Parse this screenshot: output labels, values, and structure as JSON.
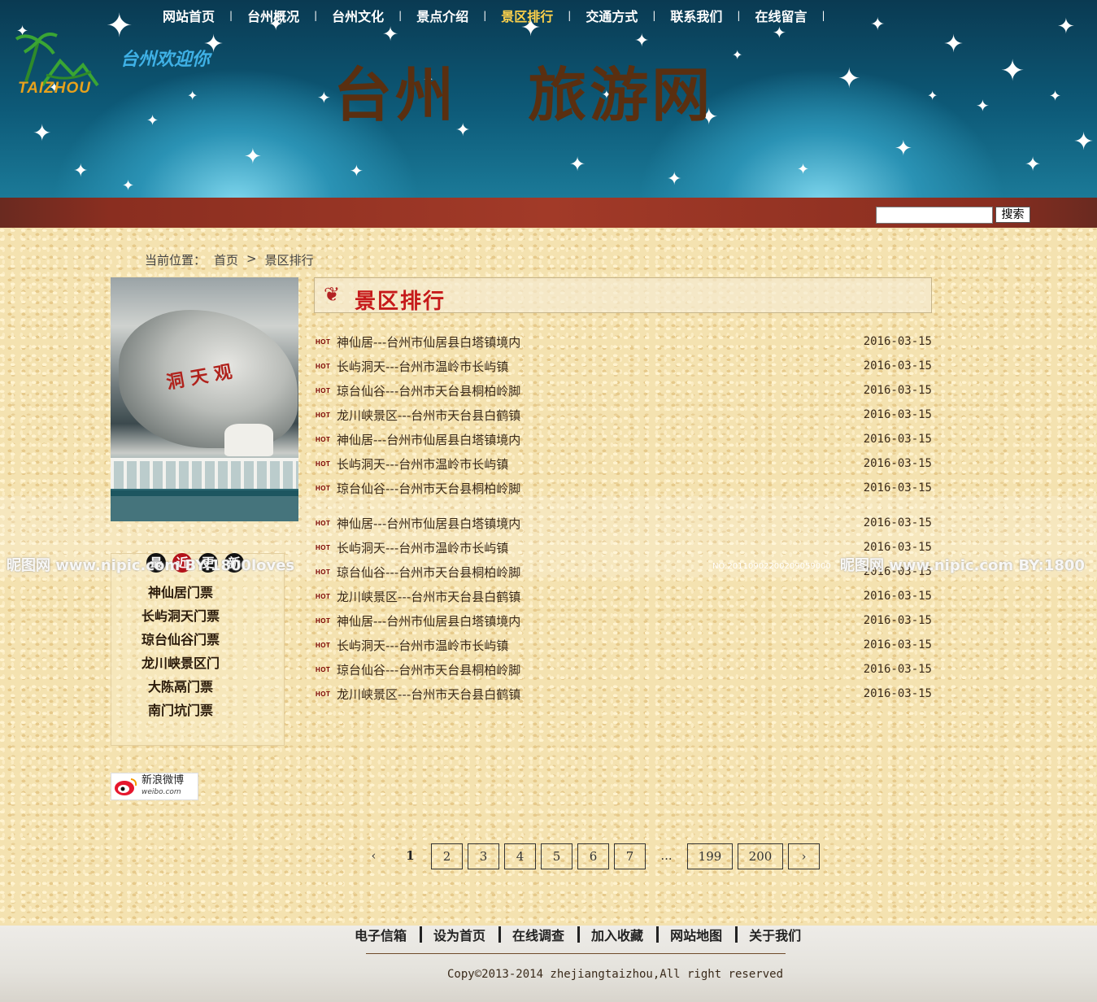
{
  "header": {
    "logo_text": "TAIZHOU",
    "welcome": "台州欢迎你",
    "site_title": "台州   旅游网"
  },
  "nav": {
    "items": [
      {
        "label": "网站首页",
        "active": false
      },
      {
        "label": "台州概况",
        "active": false
      },
      {
        "label": "台州文化",
        "active": false
      },
      {
        "label": "景点介绍",
        "active": false
      },
      {
        "label": "景区排行",
        "active": true
      },
      {
        "label": "交通方式",
        "active": false
      },
      {
        "label": "联系我们",
        "active": false
      },
      {
        "label": "在线留言",
        "active": false
      }
    ],
    "separator": "|",
    "search_value": "",
    "search_button": "搜索"
  },
  "breadcrumb": {
    "prefix": "当前位置：",
    "home": "首页",
    "arrow": ">",
    "current": "景区排行"
  },
  "left": {
    "photo_text": "洞 天 观",
    "ticket_header": [
      "最",
      "近",
      "更",
      "新"
    ],
    "tickets": [
      "神仙居门票",
      "长屿洞天门票",
      "琼台仙谷门票",
      "龙川峡景区门",
      "大陈鬲门票",
      "南门坑门票"
    ],
    "weibo_label": "新浪微博",
    "weibo_domain": "weibo.com"
  },
  "main": {
    "panel_title": "景区排行",
    "hot_label": "HOT",
    "rows": [
      {
        "text": "神仙居---台州市仙居县白塔镇境内",
        "date": "2016-03-15"
      },
      {
        "text": "长屿洞天---台州市温岭市长屿镇",
        "date": "2016-03-15"
      },
      {
        "text": "琼台仙谷---台州市天台县桐柏岭脚",
        "date": "2016-03-15"
      },
      {
        "text": "龙川峡景区---台州市天台县白鹤镇",
        "date": "2016-03-15"
      },
      {
        "text": "神仙居---台州市仙居县白塔镇境内",
        "date": "2016-03-15"
      },
      {
        "text": "长屿洞天---台州市温岭市长屿镇",
        "date": "2016-03-15"
      },
      {
        "text": "琼台仙谷---台州市天台县桐柏岭脚",
        "date": "2016-03-15"
      },
      {
        "text": "神仙居---台州市仙居县白塔镇境内",
        "date": "2016-03-15"
      },
      {
        "text": "长屿洞天---台州市温岭市长屿镇",
        "date": "2016-03-15"
      },
      {
        "text": "琼台仙谷---台州市天台县桐柏岭脚",
        "date": "2016-03-15"
      },
      {
        "text": "龙川峡景区---台州市天台县白鹤镇",
        "date": "2016-03-15"
      },
      {
        "text": "神仙居---台州市仙居县白塔镇境内",
        "date": "2016-03-15"
      },
      {
        "text": "长屿洞天---台州市温岭市长屿镇",
        "date": "2016-03-15"
      },
      {
        "text": "琼台仙谷---台州市天台县桐柏岭脚",
        "date": "2016-03-15"
      },
      {
        "text": "龙川峡景区---台州市天台县白鹤镇",
        "date": "2016-03-15"
      }
    ]
  },
  "watermark": {
    "left": "昵图网 www.nipic.com BY:1800loves",
    "right": "昵图网 www.nipic.com BY:1800",
    "id": "NO:20110902200209059000"
  },
  "pagination": {
    "prev": "‹",
    "current": "1",
    "pages": [
      "2",
      "3",
      "4",
      "5",
      "6",
      "7"
    ],
    "ellipsis": "...",
    "last_pages": [
      "199",
      "200"
    ],
    "next": "›"
  },
  "footer": {
    "links": [
      "电子信箱",
      "设为首页",
      "在线调查",
      "加入收藏",
      "网站地图",
      "关于我们"
    ],
    "copyright": "Copy©2013-2014 zhejiangtaizhou,All right reserved"
  }
}
